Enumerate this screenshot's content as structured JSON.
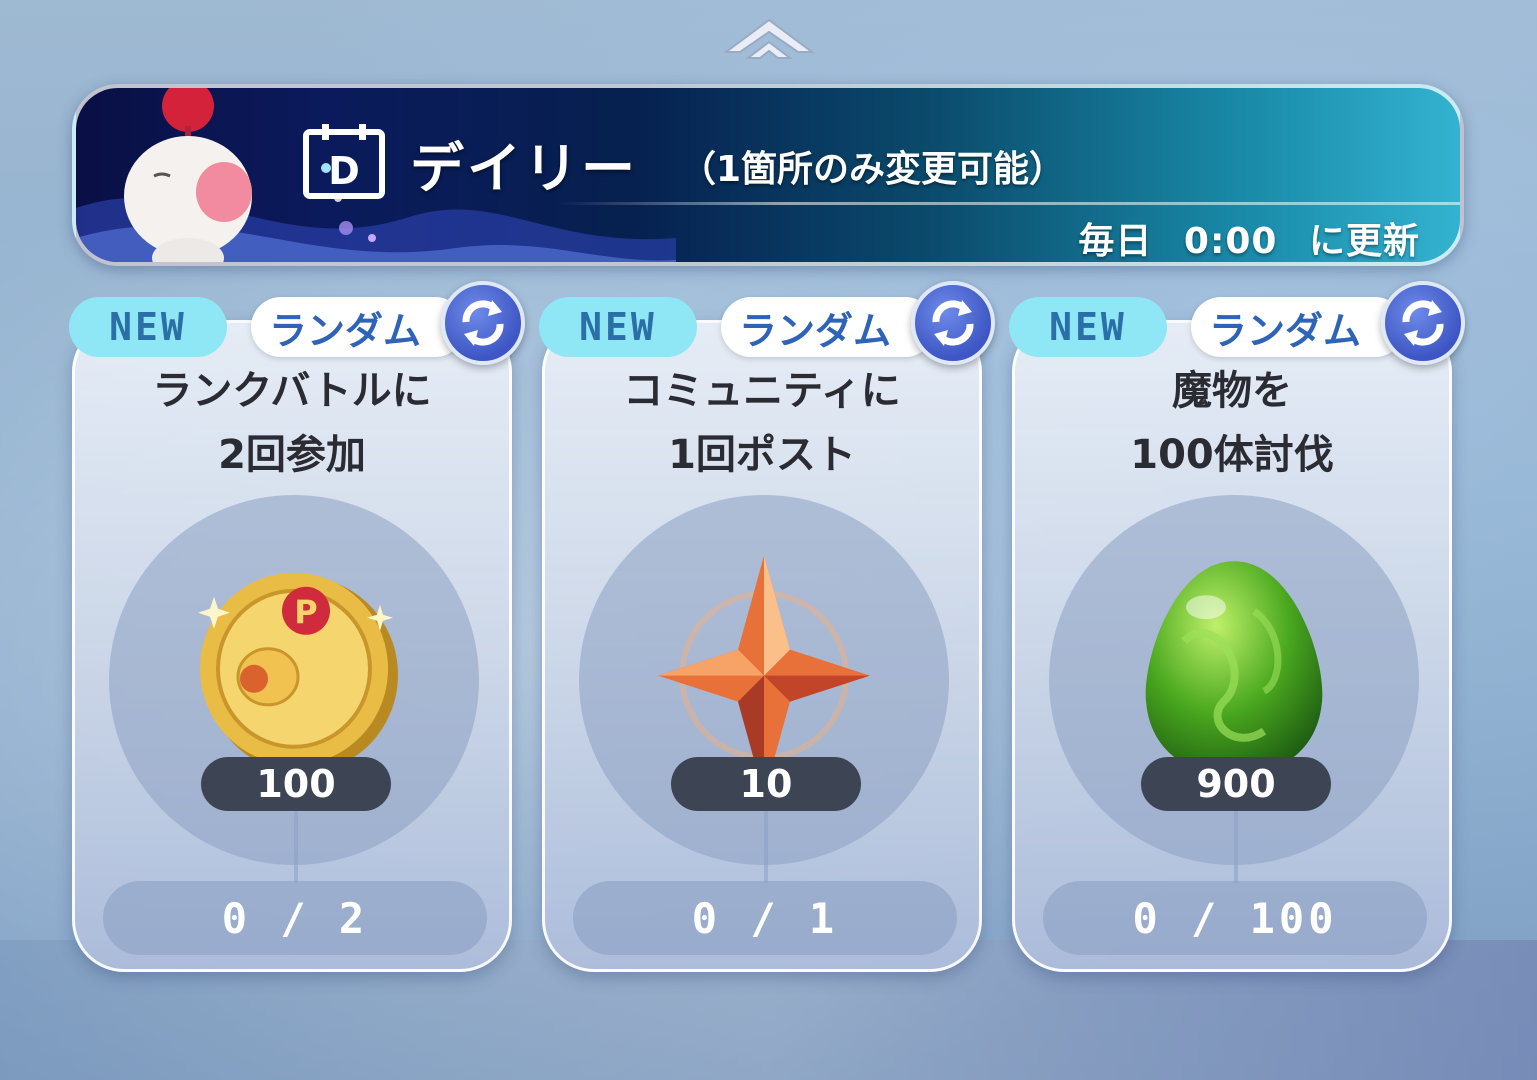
{
  "header": {
    "title": "デイリー",
    "subtitle": "（1箇所のみ変更可能）",
    "reset_text": "毎日 0:00 に更新"
  },
  "missions": [
    {
      "new_badge": "NEW",
      "type_badge": "ランダム",
      "line1": "ランクバトルに",
      "line2": "2回参加",
      "reward_icon": "gold-coin-icon",
      "reward_qty": "100",
      "progress": "0 / 2"
    },
    {
      "new_badge": "NEW",
      "type_badge": "ランダム",
      "line1": "コミュニティに",
      "line2": "1回ポスト",
      "reward_icon": "star-crystal-icon",
      "reward_qty": "10",
      "progress": "0 / 1"
    },
    {
      "new_badge": "NEW",
      "type_badge": "ランダム",
      "line1": "魔物を",
      "line2": "100体討伐",
      "reward_icon": "green-egg-icon",
      "reward_qty": "900",
      "progress": "0 / 100"
    }
  ],
  "colors": {
    "new_badge_bg": "#8fe6f5",
    "reroll_button": "#3d56c4",
    "qty_pill": "#3d4454"
  }
}
